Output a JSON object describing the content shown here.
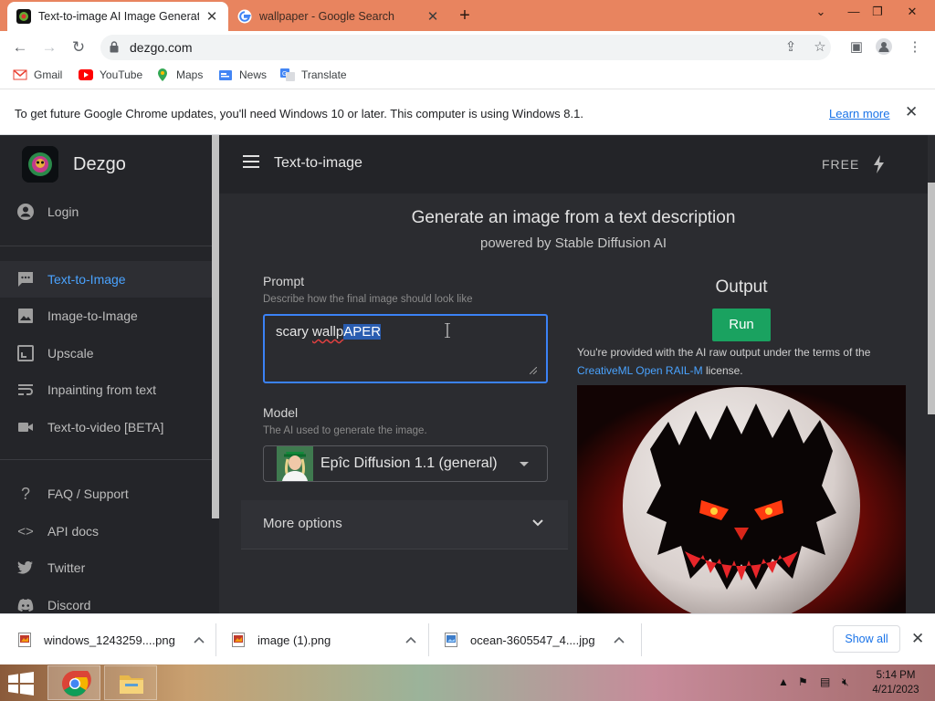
{
  "browser": {
    "tabs": [
      {
        "title": "Text-to-image AI Image Generato",
        "active": true
      },
      {
        "title": "wallpaper - Google Search",
        "active": false
      }
    ],
    "url": "dezgo.com",
    "bookmarks": [
      "Gmail",
      "YouTube",
      "Maps",
      "News",
      "Translate"
    ],
    "infobar": {
      "message": "To get future Google Chrome updates, you'll need Windows 10 or later. This computer is using Windows 8.1.",
      "link": "Learn more"
    }
  },
  "app": {
    "brand": "Dezgo",
    "login": "Login",
    "nav": [
      "Text-to-Image",
      "Image-to-Image",
      "Upscale",
      "Inpainting from text",
      "Text-to-video [BETA]"
    ],
    "nav_secondary": [
      "FAQ / Support",
      "API docs",
      "Twitter",
      "Discord"
    ],
    "topbar": {
      "title": "Text-to-image",
      "plan": "FREE"
    },
    "heading": "Generate an image from a text description",
    "subheading": "powered by Stable Diffusion AI",
    "prompt": {
      "label": "Prompt",
      "hint": "Describe how the final image should look like",
      "value_prefix": "scary ",
      "value_misspelled": "wallp",
      "value_selected": "APER"
    },
    "model": {
      "label": "Model",
      "hint": "The AI used to generate the image.",
      "value": "Epîc Diffusion 1.1 (general)"
    },
    "more_options": "More options",
    "output": {
      "title": "Output",
      "run": "Run",
      "terms_pre": "You're provided with the AI raw output under the terms of the",
      "terms_link": "CreativeML Open RAIL-M",
      "terms_post": "license."
    }
  },
  "downloads": {
    "items": [
      "windows_1243259....png",
      "image (1).png",
      "ocean-3605547_4....jpg"
    ],
    "show_all": "Show all"
  },
  "taskbar": {
    "time": "5:14 PM",
    "date": "4/21/2023"
  },
  "colors": {
    "tabstrip": "#e8845f",
    "accent_blue": "#4aa3ff",
    "run_green": "#1aa260",
    "page_bg": "#2b2c30"
  }
}
